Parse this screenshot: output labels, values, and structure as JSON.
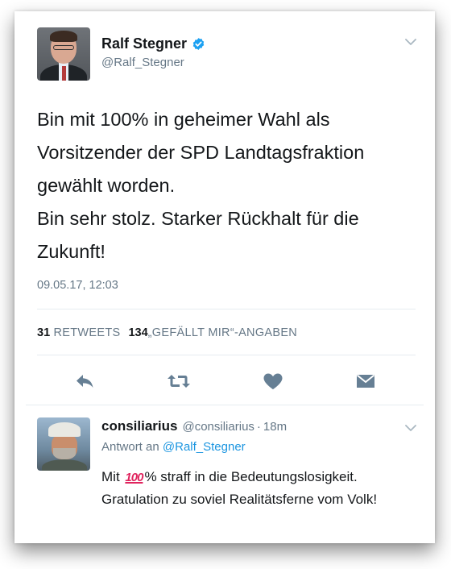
{
  "tweet": {
    "author": {
      "display_name": "Ralf Stegner",
      "handle": "@Ralf_Stegner",
      "verified": true
    },
    "text": "Bin mit 100%  in geheimer Wahl als\nVorsitzender der SPD Landtagsfraktion\ngewählt worden.\nBin sehr stolz. Starker Rückhalt für die\nZukunft!",
    "timestamp": "09.05.17, 12:03",
    "stats": {
      "retweets_count": "31",
      "retweets_label": "RETWEETS",
      "likes_count": "134",
      "likes_label": "„GEFÄLLT MIR“-ANGABEN"
    },
    "actions": [
      "reply-icon",
      "retweet-icon",
      "heart-icon",
      "direct-message-icon"
    ]
  },
  "reply": {
    "display_name": "consiliarius",
    "handle": "@consiliarius",
    "separator": "·",
    "time": "18m",
    "reply_prefix": "Antwort an",
    "reply_to": "@Ralf_Stegner",
    "text_before": "Mit",
    "emoji": "100",
    "text_after": "% straff in die Bedeutungslosigkeit. Gratulation zu soviel Realitätsferne vom Volk!"
  },
  "colors": {
    "text": "#14171a",
    "secondary": "#657786",
    "link": "#1b95e0",
    "verified": "#1da1f2",
    "emoji_red": "#e0245e",
    "divider": "#e6ecf0"
  }
}
